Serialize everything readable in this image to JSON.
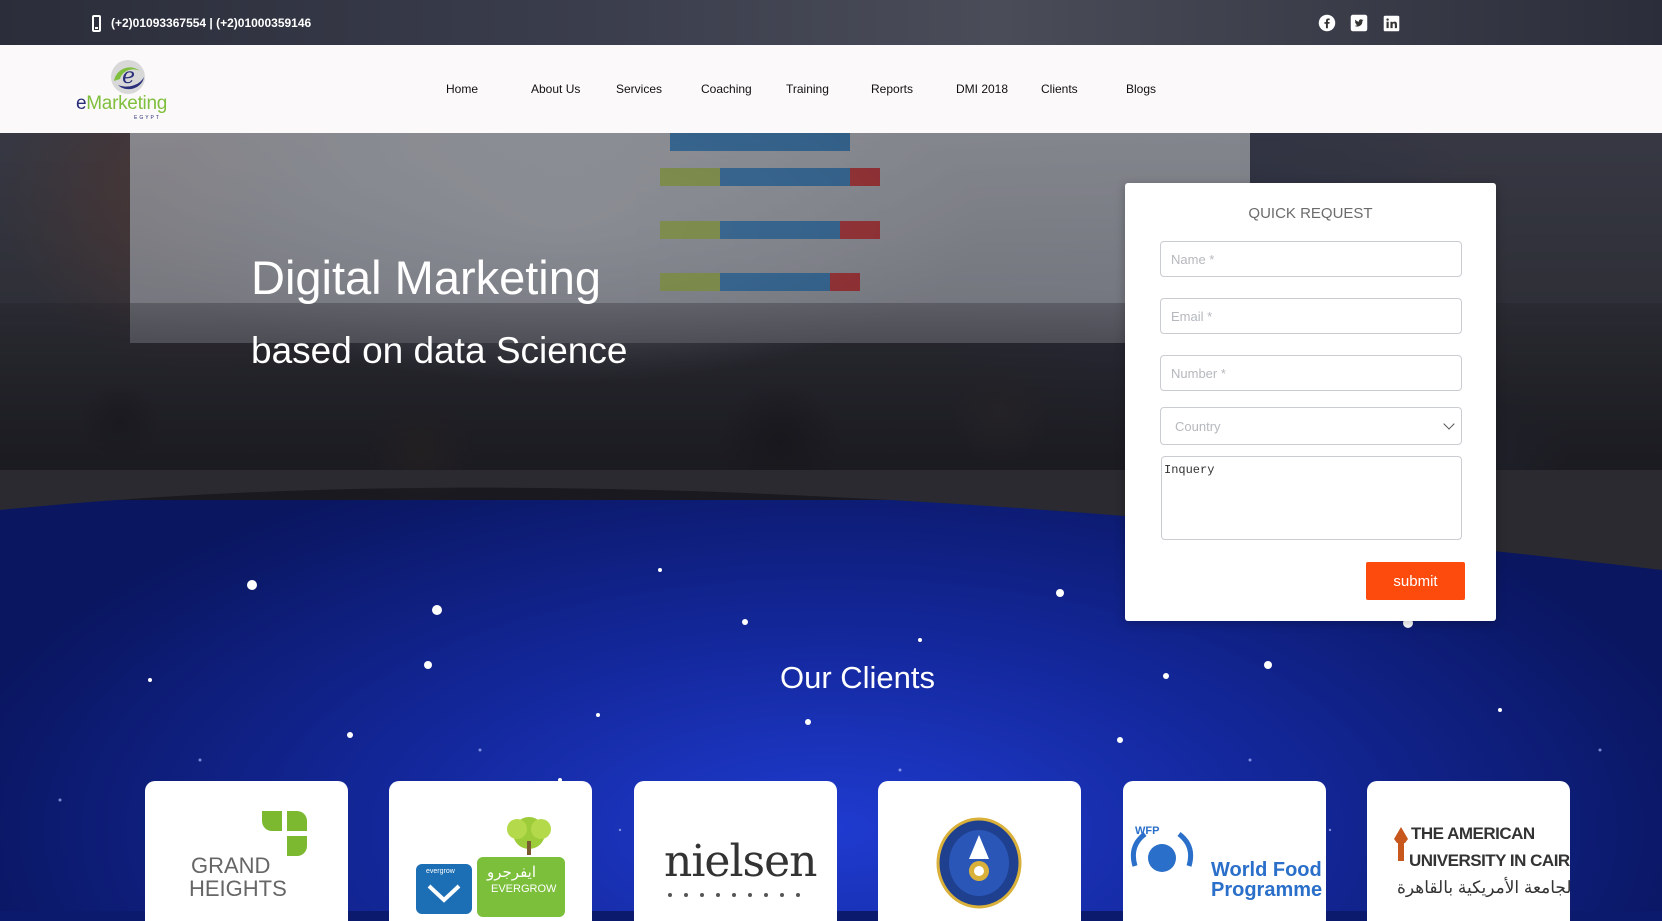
{
  "topbar": {
    "phone": "(+2)01093367554 | (+2)01000359146",
    "phone_icon": "mobile-phone-icon",
    "social": [
      "facebook-icon",
      "twitter-icon",
      "linkedin-icon"
    ]
  },
  "brand": {
    "logo_letter": "e",
    "logo_text_e": "e",
    "logo_text_rest": "Marketing",
    "logo_sub": "EGYPT"
  },
  "nav": [
    {
      "label": "Home"
    },
    {
      "label": "About Us"
    },
    {
      "label": "Services"
    },
    {
      "label": "Coaching"
    },
    {
      "label": "Training"
    },
    {
      "label": "Reports"
    },
    {
      "label": "DMI 2018"
    },
    {
      "label": "Clients"
    },
    {
      "label": "Blogs"
    }
  ],
  "hero": {
    "title": "Digital Marketing",
    "subtitle": "based on data Science"
  },
  "quick_request": {
    "title": "QUICK REQUEST",
    "name_placeholder": "Name *",
    "email_placeholder": "Email *",
    "number_placeholder": "Number *",
    "country_value": "Country",
    "inquiry_placeholder": "Inquery",
    "submit_label": "submit"
  },
  "clients": {
    "title": "Our Clients",
    "logos": [
      {
        "line1": "GRAND",
        "line2": "HEIGHTS"
      },
      {
        "arabic": "ايفرجرو",
        "latin": "EVERGROW",
        "small": "evergrow"
      },
      {
        "name": "nielsen"
      },
      {
        "name": "emblem"
      },
      {
        "abbr": "WFP",
        "line1": "World Food",
        "line2": "Programme"
      },
      {
        "line1": "THE AMERICAN",
        "line2": "UNIVERSITY IN CAIRO",
        "arabic": "الجامعة الأمريكية بالقاهرة"
      }
    ]
  },
  "colors": {
    "submit": "#fd4b0e",
    "nav_bg": "#fcf9fa",
    "space": "#13279a",
    "logo_green": "#7fbf3e",
    "logo_blue": "#2a2f7a"
  }
}
